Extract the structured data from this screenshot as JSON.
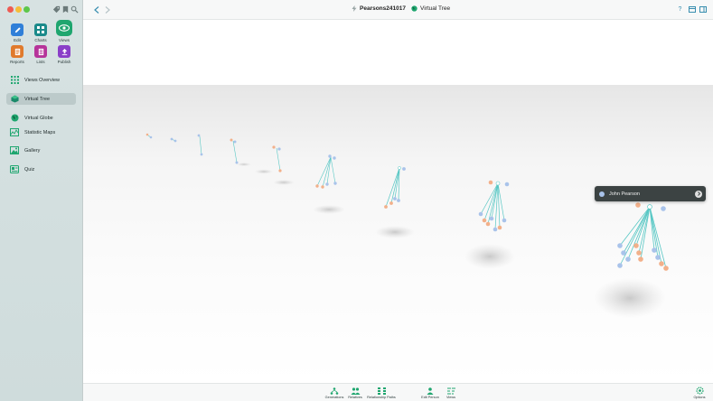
{
  "header": {
    "document_title": "Pearsons241017",
    "view_title": "Virtual Tree"
  },
  "toolbar": {
    "edit_label": "Edit",
    "charts_label": "Charts",
    "views_label": "Views",
    "reports_label": "Reports",
    "lists_label": "Lists",
    "publish_label": "Publish"
  },
  "sidebar": {
    "items": [
      {
        "label": "Views Overview",
        "icon": "grid-icon"
      },
      {
        "label": "Virtual Tree",
        "icon": "cube-icon",
        "selected": true
      },
      {
        "label": "Virtual Globe",
        "icon": "globe-icon"
      },
      {
        "label": "Statistic Maps",
        "icon": "map-icon"
      },
      {
        "label": "Gallery",
        "icon": "gallery-icon"
      },
      {
        "label": "Quiz",
        "icon": "quiz-icon"
      }
    ]
  },
  "popover": {
    "person_name": "John Pearson"
  },
  "bottom_toolbar": {
    "items": [
      {
        "label": "Generations"
      },
      {
        "label": "Relatives"
      },
      {
        "label": "Relationship Paths"
      },
      {
        "label": "Edit Person"
      },
      {
        "label": "Views"
      },
      {
        "label": "Options"
      }
    ]
  },
  "colors": {
    "accent": "#1fa66f",
    "edit": "#2f7fd8",
    "charts": "#1a8a8a",
    "reports": "#e07a2c",
    "lists": "#b6349a",
    "publish": "#8a3fc8",
    "tree_link": "#57c7c4",
    "male": "#a9c3ea",
    "female": "#f2b08a",
    "popover_bg": "#3c4343"
  }
}
